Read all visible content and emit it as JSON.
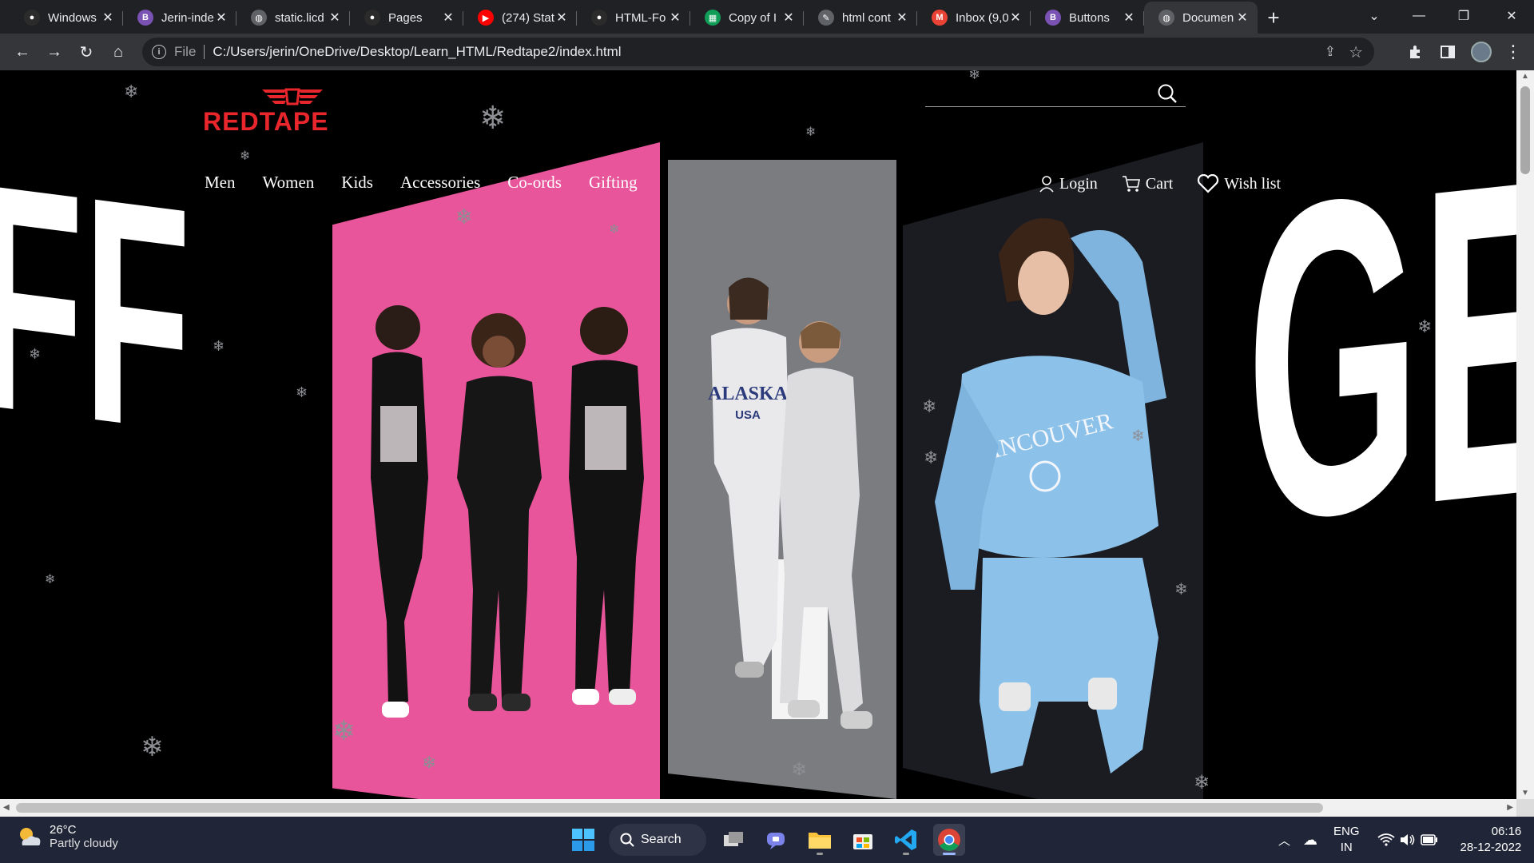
{
  "browser": {
    "tabs": [
      {
        "title": "Windows",
        "favicon": "github-icon",
        "fav_color": "#2b2b2b",
        "active": false
      },
      {
        "title": "Jerin-inde",
        "favicon": "bootstrap-icon",
        "fav_color": "#7952b3",
        "active": false
      },
      {
        "title": "static.licd",
        "favicon": "globe-icon",
        "fav_color": "#5f6368",
        "active": false
      },
      {
        "title": "Pages",
        "favicon": "github-icon",
        "fav_color": "#2b2b2b",
        "active": false
      },
      {
        "title": "(274) Stat",
        "favicon": "youtube-icon",
        "fav_color": "#ff0000",
        "active": false
      },
      {
        "title": "HTML-Fo",
        "favicon": "github-icon",
        "fav_color": "#2b2b2b",
        "active": false
      },
      {
        "title": "Copy of I",
        "favicon": "sheets-icon",
        "fav_color": "#0f9d58",
        "active": false
      },
      {
        "title": "html cont",
        "favicon": "code-icon",
        "fav_color": "#5f6368",
        "active": false
      },
      {
        "title": "Inbox (9,0",
        "favicon": "gmail-icon",
        "fav_color": "#ea4335",
        "active": false
      },
      {
        "title": "Buttons",
        "favicon": "bootstrap-icon",
        "fav_color": "#7952b3",
        "active": false
      },
      {
        "title": "Documen",
        "favicon": "globe-icon",
        "fav_color": "#5f6368",
        "active": true
      }
    ],
    "address": {
      "scheme": "File",
      "url": "C:/Users/jerin/OneDrive/Desktop/Learn_HTML/Redtape2/index.html"
    }
  },
  "site": {
    "brand": "REDTAPE",
    "brand_color": "#e8262c",
    "search_placeholder": "",
    "nav": [
      "Men",
      "Women",
      "Kids",
      "Accessories",
      "Co-ords",
      "Gifting"
    ],
    "user_nav": {
      "login": "Login",
      "cart": "Cart",
      "wishlist": "Wish list"
    },
    "hero": {
      "left_letters": "FF",
      "right_letters": "GE",
      "panels": [
        {
          "name": "kids-panel",
          "bg": "#e8559a"
        },
        {
          "name": "alaska-panel",
          "bg": "#7a7c80"
        },
        {
          "name": "vancouver-panel",
          "bg": "#1b1c22"
        }
      ],
      "shirt_texts": [
        "ALASKA",
        "USA",
        "VANCOUVER"
      ]
    }
  },
  "taskbar": {
    "weather_temp": "26°C",
    "weather_desc": "Partly cloudy",
    "search_label": "Search",
    "lang": "ENG",
    "region": "IN",
    "time": "06:16",
    "date": "28-12-2022"
  }
}
